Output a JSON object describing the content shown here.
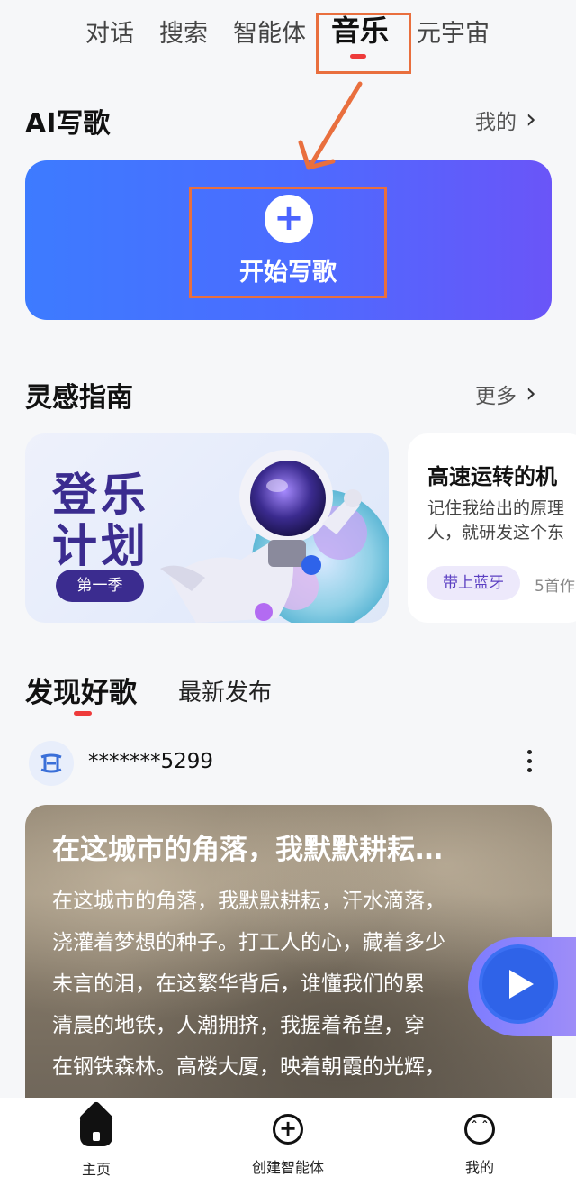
{
  "top_tabs": [
    "对话",
    "搜索",
    "智能体",
    "音乐",
    "元宇宙"
  ],
  "active_tab": "音乐",
  "ai_write": {
    "title": "AI写歌",
    "my_link": "我的",
    "start_label": "开始写歌"
  },
  "inspiration": {
    "title": "灵感指南",
    "more_link": "更多",
    "card1": {
      "title_line1": "登乐",
      "title_line2": "计划",
      "badge": "第一季"
    },
    "card2": {
      "title": "高速运转的机",
      "desc_line1": "记住我给出的原理",
      "desc_line2": "人，就研发这个东",
      "tag": "带上蓝牙",
      "count": "5首作"
    }
  },
  "discover": {
    "tab_active": "发现好歌",
    "tab_other": "最新发布"
  },
  "post": {
    "username": "*******5299",
    "song_title": "在这城市的角落，我默默耕耘…",
    "lyrics": [
      "在这城市的角落，我默默耕耘，汗水滴落，",
      "浇灌着梦想的种子。打工人的心，藏着多少",
      "未言的泪，在这繁华背后，谁懂我们的累",
      "清晨的地铁，人潮拥挤，我握着希望，穿",
      "在钢铁森林。高楼大厦，映着朝霞的光辉，"
    ]
  },
  "bottom_nav": [
    "主页",
    "创建智能体",
    "我的"
  ],
  "colors": {
    "accent_red": "#ee3b3b",
    "card_blue": "#4b6cff",
    "highlight_orange": "#e96f3e",
    "badge_purple": "#3b2c8f"
  }
}
